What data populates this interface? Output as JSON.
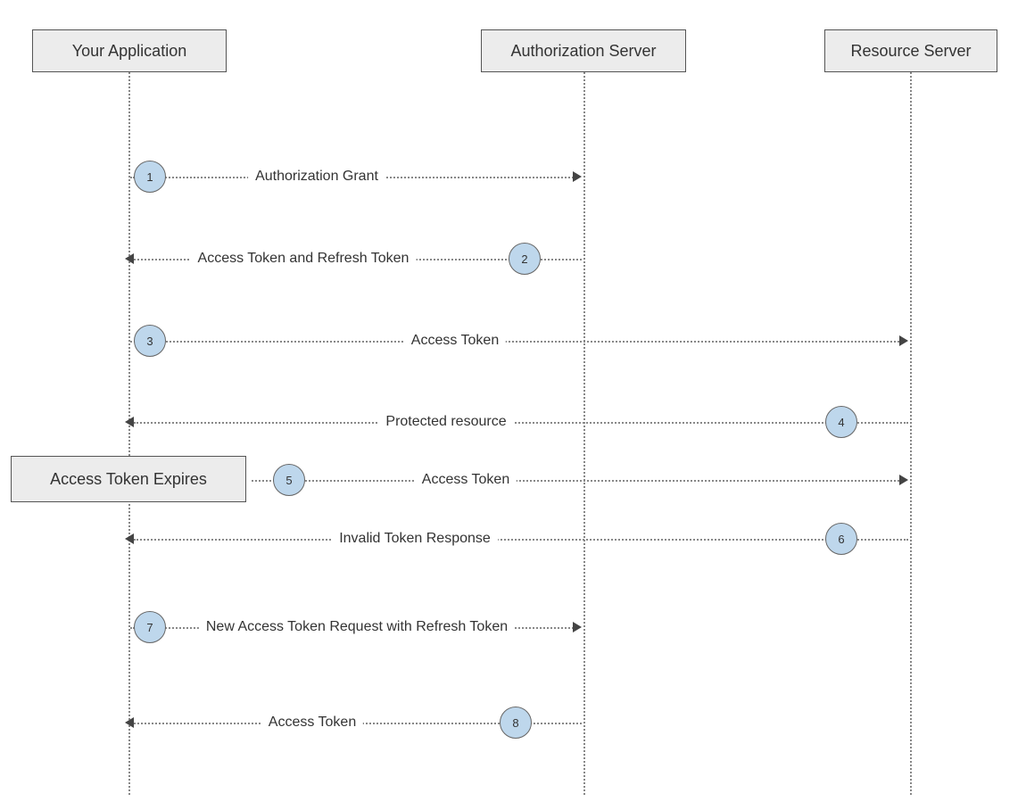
{
  "actors": {
    "app": "Your Application",
    "auth": "Authorization Server",
    "res": "Resource Server"
  },
  "note": "Access Token Expires",
  "steps": [
    {
      "num": "1",
      "label": "Authorization Grant"
    },
    {
      "num": "2",
      "label": "Access Token and Refresh Token"
    },
    {
      "num": "3",
      "label": "Access Token"
    },
    {
      "num": "4",
      "label": "Protected resource"
    },
    {
      "num": "5",
      "label": "Access Token"
    },
    {
      "num": "6",
      "label": "Invalid Token Response"
    },
    {
      "num": "7",
      "label": "New Access Token Request with Refresh Token"
    },
    {
      "num": "8",
      "label": "Access Token"
    }
  ],
  "colors": {
    "fill": "#bed7ec",
    "box": "#ececec",
    "line": "#888"
  }
}
